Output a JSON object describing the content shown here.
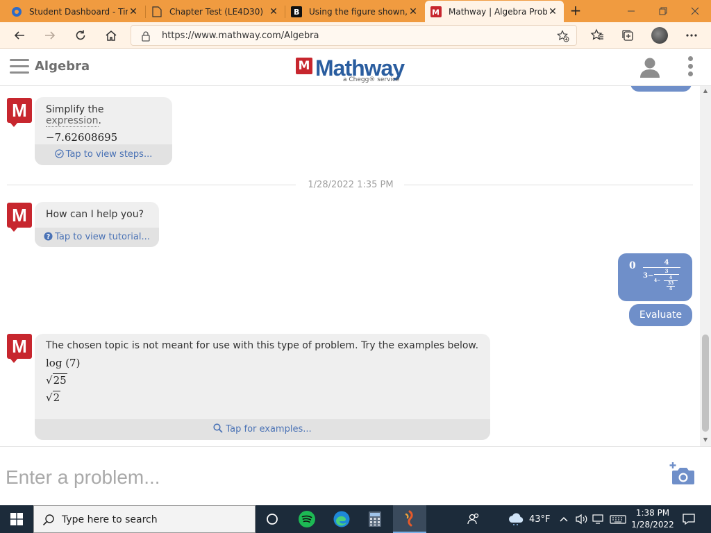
{
  "browser": {
    "tabs": [
      {
        "title": "Student Dashboard - Tim",
        "favicon": "canvas-dashboard-icon",
        "active": false
      },
      {
        "title": "Chapter Test (LE4D30)",
        "favicon": "document-icon",
        "active": false
      },
      {
        "title": "Using the figure shown, f",
        "favicon": "brainly-icon",
        "active": false
      },
      {
        "title": "Mathway | Algebra Proble",
        "favicon": "mathway-icon",
        "active": true
      }
    ],
    "url": "https://www.mathway.com/Algebra"
  },
  "header": {
    "topic": "Algebra",
    "logo_mark": "M",
    "logo_text": "Mathway",
    "logo_sub": "a Chegg® service"
  },
  "chat": {
    "msg1": {
      "text_before": "Simplify the ",
      "link": "expression",
      "text_after": ".",
      "result": "−7.62608695",
      "footer": "Tap to view steps..."
    },
    "timestamp": "1/28/2022 1:35 PM",
    "msg2": {
      "text": "How can I help you?",
      "footer": "Tap to view tutorial..."
    },
    "user_msg": {
      "lead": "0",
      "outer_num": "4",
      "outer_den_lead": "3−",
      "mid_num": "3",
      "mid_den_lead": "4−",
      "inner_num": "4",
      "inner_den_num": "33",
      "inner_den_den": "4"
    },
    "evaluate_label": "Evaluate",
    "msg3": {
      "text": "The chosen topic is not meant for use with this type of problem. Try the examples below.",
      "example1": "log (7)",
      "example2_radicand": "25",
      "example3_radicand": "2",
      "root_symbol": "√",
      "footer": "Tap for examples..."
    }
  },
  "input": {
    "placeholder": "Enter a problem..."
  },
  "taskbar": {
    "search_placeholder": "Type here to search",
    "weather": "43°F",
    "time": "1:38 PM",
    "date": "1/28/2022"
  },
  "colors": {
    "tabstrip": "#f09b40",
    "mathway_red": "#c7262e",
    "mathway_blue": "#2a5d9f",
    "user_bubble": "#6f8fc9",
    "link_blue": "#4a72b5"
  }
}
